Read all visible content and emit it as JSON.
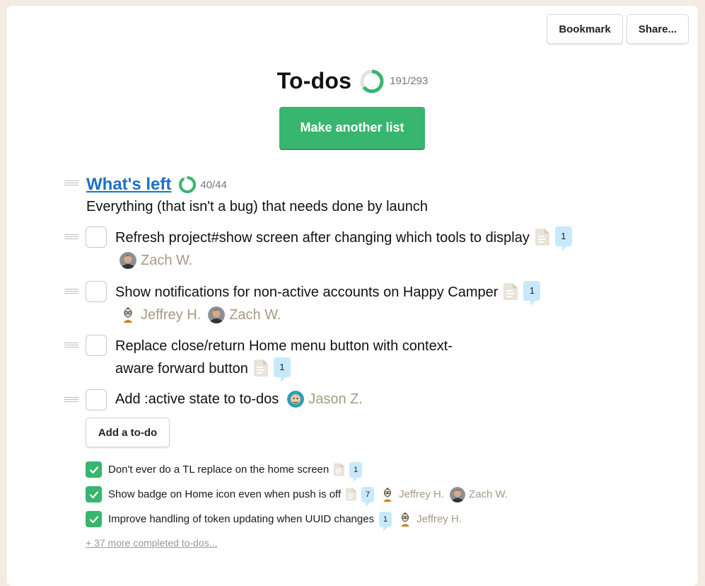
{
  "toolbar": {
    "bookmark_label": "Bookmark",
    "share_label": "Share..."
  },
  "header": {
    "title": "To-dos",
    "progress_done": 191,
    "progress_total": 293,
    "progress_label": "191/293",
    "make_list_label": "Make another list"
  },
  "colors": {
    "accent_green": "#38b56e",
    "link_blue": "#1e6fc7",
    "assignee_tan": "#a79a82",
    "comment_blue": "#c8e9fb",
    "page_bg": "#f4ece2"
  },
  "list": {
    "title": "What's left",
    "progress_done": 40,
    "progress_total": 44,
    "progress_label": "40/44",
    "description": "Everything (that isn't a bug) that needs done by launch",
    "todos": [
      {
        "text": "Refresh project#show screen after changing which tools to display",
        "has_notes": true,
        "comments": "1",
        "assignees": [
          "Zach W."
        ]
      },
      {
        "text": "Show notifications for non-active accounts on Happy Camper",
        "has_notes": true,
        "comments": "1",
        "assignees": [
          "Jeffrey H.",
          "Zach W."
        ]
      },
      {
        "text_line1": "Replace close/return Home menu button with context-",
        "text_line2": "aware forward button",
        "has_notes": true,
        "comments": "1",
        "assignees": []
      },
      {
        "text": "Add :active state to to-dos",
        "has_notes": false,
        "comments": null,
        "assignees": [
          "Jason Z."
        ]
      }
    ],
    "add_todo_label": "Add a to-do",
    "completed": [
      {
        "text": "Don't ever do a TL replace on the home screen",
        "has_notes": true,
        "comments": "1",
        "assignees": []
      },
      {
        "text": "Show badge on Home icon even when push is off",
        "has_notes": true,
        "comments": "7",
        "assignees": [
          "Jeffrey H.",
          "Zach W."
        ]
      },
      {
        "text": "Improve handling of token updating when UUID changes",
        "has_notes": false,
        "comments": "1",
        "assignees": [
          "Jeffrey H."
        ]
      }
    ],
    "more_completed_label": "+ 37 more completed to-dos..."
  }
}
